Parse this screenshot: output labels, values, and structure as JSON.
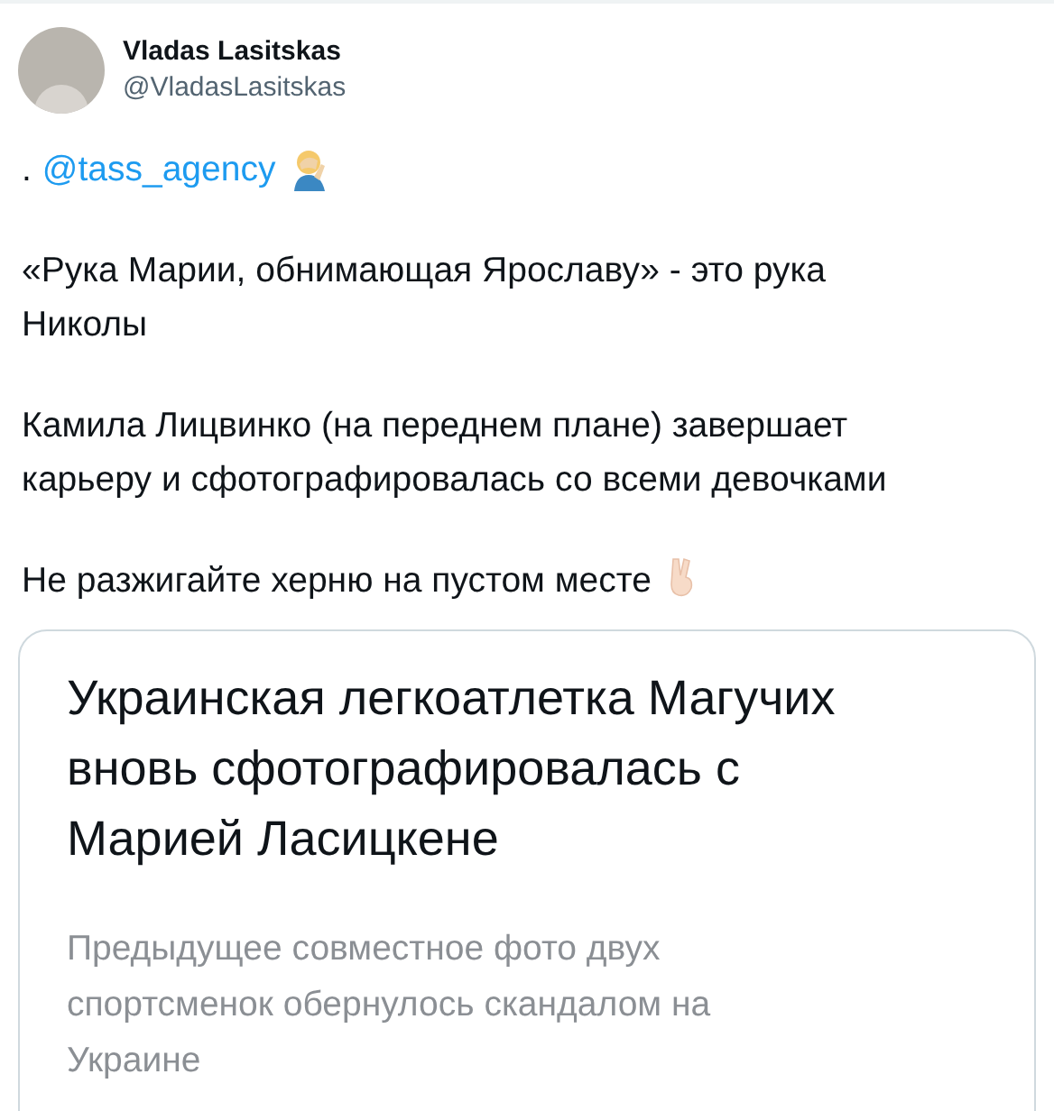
{
  "author": {
    "name": "Vladas Lasitskas",
    "handle": "@VladasLasitskas"
  },
  "lead": {
    "prefix": ".",
    "mention": "@tass_agency"
  },
  "paragraphs": [
    {
      "text": "«Рука Марии, обнимающая Ярославу» - это рука Николы",
      "kind": "plain"
    },
    {
      "text": "Камила Лицвинко (на переднем плане) завершает карьеру и сфотографировалась со всеми девочками",
      "kind": "plain"
    },
    {
      "text": "Не разжигайте херню на пустом месте",
      "kind": "with_victory_hand"
    }
  ],
  "card": {
    "title": "Украинская легкоатлетка Магучих вновь сфотографировалась с Марией Ласицкене",
    "description": "Предыдущее совместное фото двух спортсменок обернулось скандалом на Украине"
  }
}
